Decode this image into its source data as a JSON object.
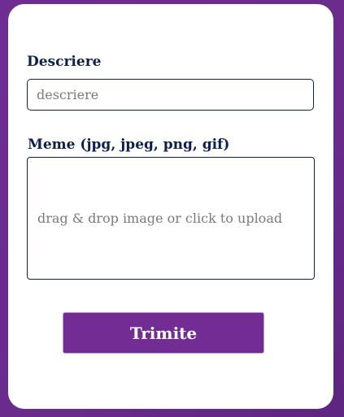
{
  "form": {
    "description_label": "Descriere",
    "description_placeholder": "descriere",
    "description_value": "",
    "meme_label": "Meme (jpg, jpeg, png, gif)",
    "dropzone_text": "drag & drop image or click to upload",
    "submit_label": "Trimite"
  },
  "colors": {
    "background": "#6a2c8c",
    "card": "#ffffff",
    "label": "#0d1f4d",
    "button": "#732c93",
    "button_text": "#ffffff",
    "placeholder": "#7a7a7a"
  }
}
